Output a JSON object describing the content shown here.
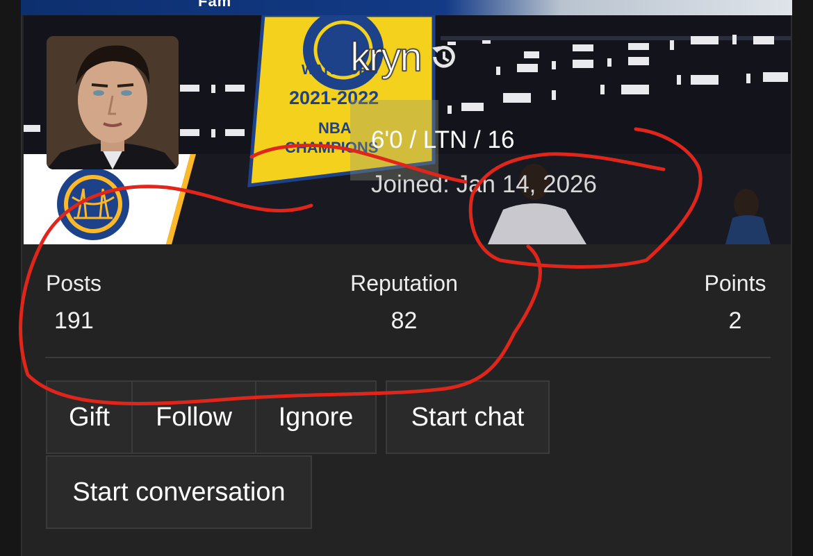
{
  "banner": {
    "top_strip_text": "Fam",
    "banner_text": {
      "champ_year": "2021-2022",
      "champ_nba": "NBA",
      "champ_word": "CHAMPIONS",
      "team_word": "WARRIORS"
    }
  },
  "profile": {
    "username": "kryn",
    "info_line": "6'0 / LTN / 16",
    "joined": "Joined: Jan 14, 2026"
  },
  "stats": [
    {
      "label": "Posts",
      "value": "191"
    },
    {
      "label": "Reputation",
      "value": "82"
    },
    {
      "label": "Points",
      "value": "2"
    }
  ],
  "actions": {
    "gift": "Gift",
    "follow": "Follow",
    "ignore": "Ignore",
    "start_chat": "Start chat",
    "start_conversation": "Start conversation"
  },
  "colors": {
    "annotation": "#e0261b",
    "warriors_blue": "#1d428a",
    "warriors_gold": "#fdb927"
  }
}
